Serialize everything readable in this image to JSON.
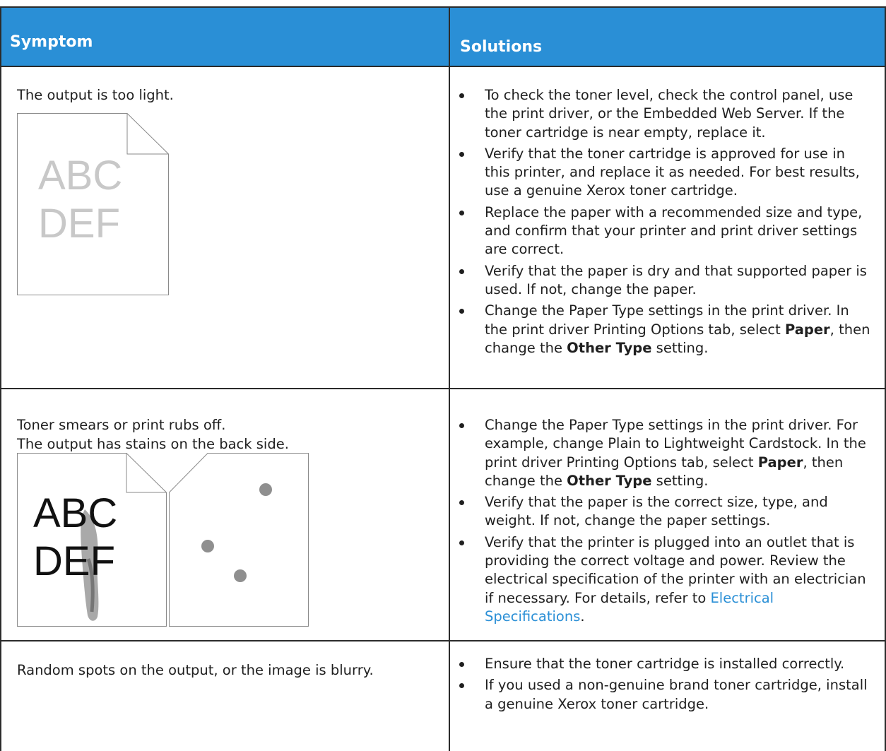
{
  "header": {
    "symptom": "Symptom",
    "solutions": "Solutions"
  },
  "rows": [
    {
      "symptom": "The output is too light.",
      "illustration_text": [
        "ABC",
        "DEF"
      ],
      "solutions": [
        "To check the toner level, check the control panel, use the print driver, or the Embedded Web Server. If the toner cartridge is near empty, replace it.",
        "Verify that the toner cartridge is approved for use in this printer, and replace it as needed. For best results, use a genuine Xerox toner cartridge.",
        "Replace the paper with a recommended size and type, and confirm that your printer and print driver settings are correct.",
        "Verify that the paper is dry and that supported paper is used. If not, change the paper.",
        {
          "pre": "Change the Paper Type settings in the print driver. In the print driver Printing Options tab, select ",
          "b1": "Paper",
          "mid": ", then change the ",
          "b2": "Other Type",
          "post": " setting."
        }
      ]
    },
    {
      "symptom_line1": "Toner smears or print rubs off.",
      "symptom_line2": "The output has stains on the back side.",
      "illustration_text": [
        "ABC",
        "DEF"
      ],
      "solutions": [
        {
          "pre": "Change the Paper Type settings in the print driver. For example, change Plain to Lightweight Cardstock. In the print driver Printing Options tab, select ",
          "b1": "Paper",
          "mid": ", then change the ",
          "b2": "Other Type",
          "post": " setting."
        },
        "Verify that the paper is the correct size, type, and weight. If not, change the paper settings.",
        {
          "pre": "Verify that the printer is plugged into an outlet that is providing the correct voltage and power. Review the electrical specification of the printer with an electrician if necessary. For details, refer to ",
          "link": "Electrical Specifications",
          "post": "."
        }
      ]
    },
    {
      "symptom": "Random spots on the output, or the image is blurry.",
      "solutions": [
        "Ensure that the toner cartridge is installed correctly.",
        "If you used a non-genuine brand toner cartridge, install a genuine Xerox toner cartridge."
      ]
    }
  ],
  "colors": {
    "header_bg": "#2a8fd6",
    "link": "#2a8fd6",
    "border": "#2b2b2b"
  }
}
